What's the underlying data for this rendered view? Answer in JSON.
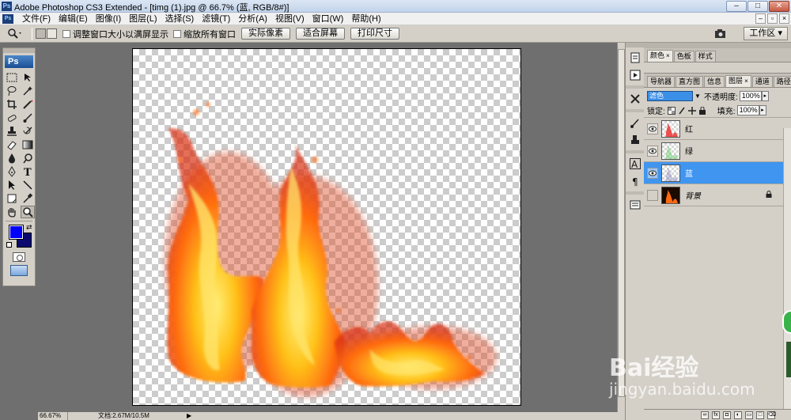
{
  "window": {
    "title": "Adobe Photoshop CS3 Extended - [timg (1).jpg @ 66.7% (蓝, RGB/8#)]",
    "buttons": [
      "–",
      "□",
      "✕"
    ]
  },
  "menu": {
    "items": [
      "文件(F)",
      "编辑(E)",
      "图像(I)",
      "图层(L)",
      "选择(S)",
      "滤镜(T)",
      "分析(A)",
      "视图(V)",
      "窗口(W)",
      "帮助(H)"
    ]
  },
  "options_bar": {
    "check_resize": "调整窗口大小以满屏显示",
    "check_zoom_all": "缩放所有窗口",
    "btn_actual": "实际像素",
    "btn_fit": "适合屏幕",
    "btn_print": "打印尺寸",
    "workspace": "工作区 ▾"
  },
  "toolbox": {
    "logo": "Ps",
    "foreground_color": "#0000ff",
    "background_color": "#0a0a6e"
  },
  "status": {
    "zoom": "66.67%",
    "doc": "文档:2.67M/10.5M"
  },
  "panel": {
    "top_tabs": [
      "颜色",
      "色板",
      "样式"
    ],
    "layer_tabs": [
      "导航器",
      "直方图",
      "信息",
      "图层",
      "通道",
      "路径"
    ],
    "blend_mode": "滤色",
    "opacity_label": "不透明度:",
    "opacity": "100%",
    "lock_label": "锁定:",
    "fill_label": "填充:",
    "fill": "100%",
    "layers": [
      {
        "name": "红",
        "visible": true,
        "selected": false
      },
      {
        "name": "绿",
        "visible": true,
        "selected": false
      },
      {
        "name": "蓝",
        "visible": true,
        "selected": true
      },
      {
        "name": "背景",
        "visible": false,
        "selected": false,
        "locked": true
      }
    ],
    "footer_icons": [
      "fx",
      "mask",
      "adj",
      "group",
      "new",
      "trash"
    ]
  },
  "watermark": {
    "text": "Bai经验",
    "url": "jingyan.baidu.com"
  }
}
